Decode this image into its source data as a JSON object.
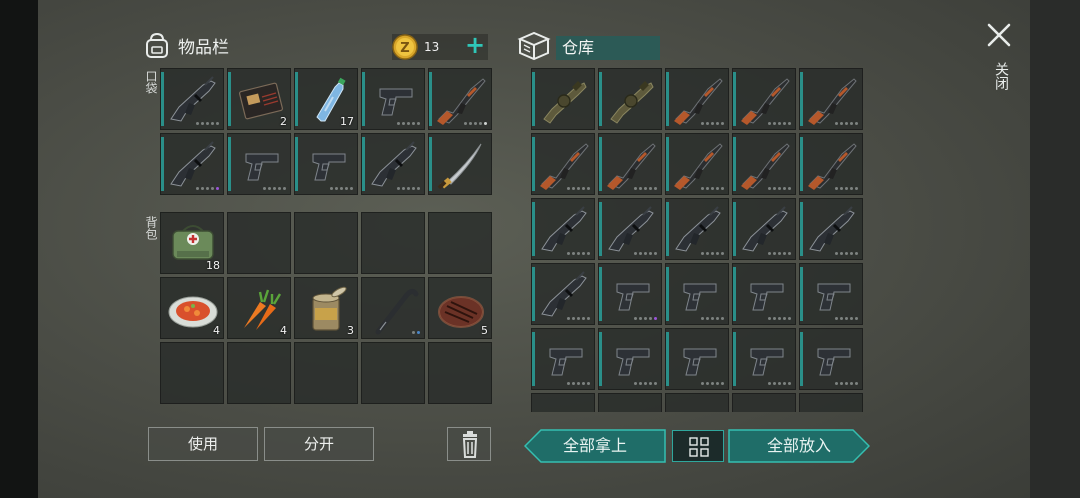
{
  "inventory": {
    "title": "物品栏",
    "coins": "13",
    "add_coins_label": "+",
    "pocket_label": "口袋",
    "backpack_label": "背包",
    "pocket_slots": [
      {
        "icon": "assault-rifle-icon",
        "count": "",
        "dots": "grey"
      },
      {
        "icon": "wallet-icon",
        "count": "2",
        "dots": ""
      },
      {
        "icon": "water-bottle-icon",
        "count": "17",
        "dots": ""
      },
      {
        "icon": "pistol-icon",
        "count": "",
        "dots": "grey"
      },
      {
        "icon": "ak-rifle-icon",
        "count": "",
        "dots": "light"
      },
      {
        "icon": "assault-rifle-icon",
        "count": "",
        "dots": "purple"
      },
      {
        "icon": "pistol-icon",
        "count": "",
        "dots": "grey"
      },
      {
        "icon": "pistol-icon",
        "count": "",
        "dots": "grey"
      },
      {
        "icon": "assault-rifle-icon",
        "count": "",
        "dots": "grey"
      },
      {
        "icon": "katana-icon",
        "count": "",
        "dots": ""
      }
    ],
    "backpack_slots": [
      {
        "icon": "medkit-bag-icon",
        "count": "18"
      },
      {
        "icon": "",
        "count": ""
      },
      {
        "icon": "",
        "count": ""
      },
      {
        "icon": "",
        "count": ""
      },
      {
        "icon": "",
        "count": ""
      },
      {
        "icon": "food-plate-icon",
        "count": "4"
      },
      {
        "icon": "carrot-icon",
        "count": "4"
      },
      {
        "icon": "canned-food-icon",
        "count": "3"
      },
      {
        "icon": "crowbar-icon",
        "count": "",
        "dots": "blue"
      },
      {
        "icon": "steak-icon",
        "count": "5"
      },
      {
        "icon": "",
        "count": ""
      },
      {
        "icon": "",
        "count": ""
      },
      {
        "icon": "",
        "count": ""
      },
      {
        "icon": "",
        "count": ""
      },
      {
        "icon": "",
        "count": ""
      }
    ],
    "use_button": "使用",
    "split_button": "分开"
  },
  "warehouse": {
    "title": "仓库",
    "slots": [
      "grenade-launcher-icon",
      "grenade-launcher-icon",
      "ak-rifle-icon",
      "ak-rifle-icon",
      "ak-rifle-icon",
      "ak-rifle-icon",
      "ak-rifle-icon",
      "ak-rifle-icon",
      "ak-rifle-icon",
      "ak-rifle-icon",
      "assault-rifle-icon",
      "assault-rifle-icon",
      "assault-rifle-icon",
      "assault-rifle-icon",
      "assault-rifle-icon",
      "assault-rifle-icon",
      "pistol-icon",
      "pistol-icon",
      "pistol-icon",
      "pistol-icon",
      "pistol-icon",
      "pistol-icon",
      "pistol-icon",
      "pistol-icon",
      "pistol-icon",
      "",
      "",
      "",
      "",
      ""
    ],
    "take_all_button": "全部拿上",
    "put_all_button": "全部放入"
  },
  "close_label": "关闭",
  "colors": {
    "accent": "#2fc7b8",
    "slot_marker": "#2a8f89",
    "warehouse_title_bg": "#2c5a56"
  }
}
